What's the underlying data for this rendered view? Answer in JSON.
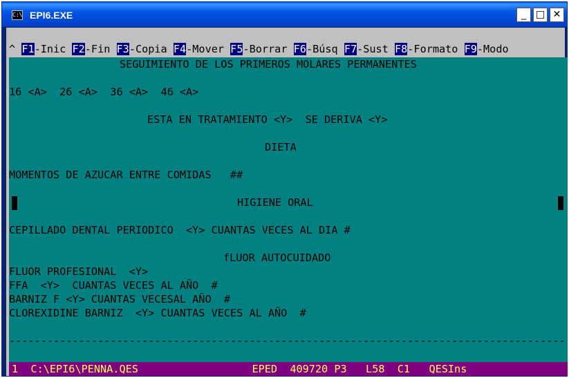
{
  "window": {
    "title": "EPI6.EXE",
    "icon": "console-icon",
    "buttons": {
      "minimize": "_",
      "maximize": "□",
      "close": "✕"
    }
  },
  "fkeys": {
    "prefix": "^",
    "items": [
      {
        "key": "F1",
        "label": "-Inic"
      },
      {
        "key": "F2",
        "label": "-Fin"
      },
      {
        "key": "F3",
        "label": "-Copia"
      },
      {
        "key": "F4",
        "label": "-Mover"
      },
      {
        "key": "F5",
        "label": "-Borrar"
      },
      {
        "key": "F6",
        "label": "-Búsq"
      },
      {
        "key": "F7",
        "label": "-Sust"
      },
      {
        "key": "F8",
        "label": "-Formato"
      },
      {
        "key": "F9",
        "label": "-Modo"
      }
    ]
  },
  "form": {
    "heading": "SEGUIMIENTO DE LOS PRIMEROS MOLARES PERMANENTES",
    "molars": "16 <A>  26 <A>  36 <A>  46 <A>",
    "treatment": "ESTA EN TRATAMIENTO <Y>  SE DERIVA <Y>",
    "diet_title": "DIETA",
    "sugar": "MOMENTOS DE AZUCAR ENTRE COMIDAS   ##",
    "hygiene_title": "HIGIENE ORAL",
    "brushing": "CEPILLADO DENTAL PERIODICO  <Y> CUANTAS VECES AL DIA #",
    "fluor_title": "fLUOR AUTOCUIDADO",
    "fluor_prof": "FLUOR PROFESIONAL  <Y>",
    "ffa": "FFA  <Y>  CUANTAS VECES AL AÑO  #",
    "barniz": "BARNIZ F <Y> CUANTAS VECESAL AÑO  #",
    "clorex": "CLOREXIDINE BARNIZ  <Y> CUANTAS VECES AL AÑO  #",
    "divider": "-----------------------------------------------------------------------------------------------"
  },
  "status": {
    "text": "1  C:\\EPI6\\PENNA.QES                  EPED  409720 P3   L58  C1   QESIns"
  }
}
